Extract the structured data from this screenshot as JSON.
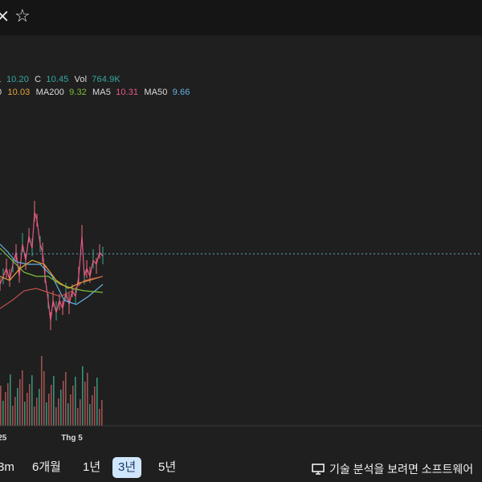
{
  "header": {
    "close_icon": "close-icon",
    "star_icon": "star-icon",
    "close_glyph": "×",
    "star_glyph": "☆"
  },
  "legend_row1": {
    "l_prefix": "L",
    "l_value": "10.20",
    "c_label": "C",
    "c_value": "10.45",
    "vol_label": "Vol",
    "vol_value": "764.9K"
  },
  "legend_row2": {
    "ma_partial_value": "10.03",
    "ma200_label": "MA200",
    "ma200_value": "9.32",
    "ma5_label": "MA5",
    "ma5_value": "10.31",
    "ma50_label": "MA50",
    "ma50_value": "9.66"
  },
  "colors": {
    "up": "#ef6b7a",
    "down": "#3aa88a",
    "ma_orange": "#e5a43c",
    "ma200_green": "#7bbf3c",
    "ma5_pink": "#e45a84",
    "ma50_blue": "#66b0e6",
    "last_price_line": "#5aa8c8",
    "volume": "#b85a5a",
    "teal_value": "#36a7a0"
  },
  "x_axis": {
    "labels": [
      {
        "text": "25",
        "pos": 0.012
      },
      {
        "text": "Thg 5",
        "pos": 0.127
      }
    ]
  },
  "ranges": {
    "items": [
      {
        "label": "3m"
      },
      {
        "label": "6개월"
      },
      {
        "label": "1년"
      },
      {
        "label": "3년"
      },
      {
        "label": "5년"
      }
    ],
    "active_index": 3
  },
  "footer": {
    "ta_message": "기술 분석을 보려면 소프트웨어"
  }
}
